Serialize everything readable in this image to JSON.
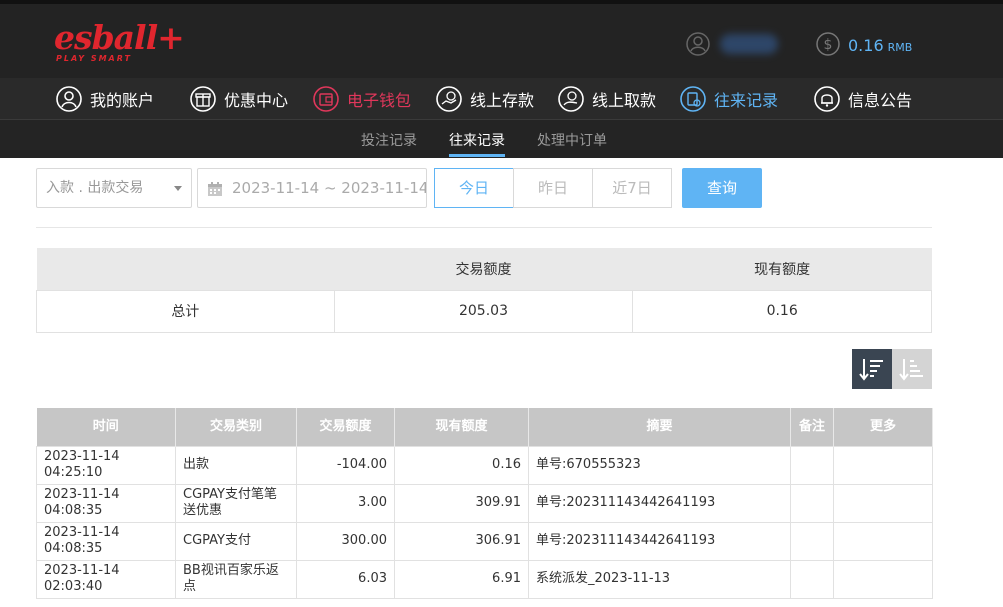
{
  "brand": {
    "logo_text": "esball+",
    "tagline": "PLAY SMART",
    "accent": "#e0262e"
  },
  "header": {
    "balance_value": "0.16",
    "balance_unit": "RMB"
  },
  "nav": [
    {
      "label": "我的账户",
      "icon": "user-icon"
    },
    {
      "label": "优惠中心",
      "icon": "gift-icon"
    },
    {
      "label": "电子钱包",
      "icon": "wallet-icon"
    },
    {
      "label": "线上存款",
      "icon": "deposit-icon"
    },
    {
      "label": "线上取款",
      "icon": "withdraw-icon"
    },
    {
      "label": "往来记录",
      "icon": "records-icon"
    },
    {
      "label": "信息公告",
      "icon": "bell-icon"
    }
  ],
  "subnav": [
    {
      "label": "投注记录"
    },
    {
      "label": "往来记录"
    },
    {
      "label": "处理中订单"
    }
  ],
  "filters": {
    "type_select": "入款 . 出款交易",
    "date_range": "2023-11-14 ~ 2023-11-14",
    "quick": [
      "今日",
      "昨日",
      "近7日"
    ],
    "query_label": "查询"
  },
  "summary": {
    "headers": [
      "",
      "交易额度",
      "现有额度"
    ],
    "row": [
      "总计",
      "205.03",
      "0.16"
    ]
  },
  "records": {
    "headers": [
      "时间",
      "交易类别",
      "交易额度",
      "现有额度",
      "摘要",
      "备注",
      "更多"
    ],
    "rows": [
      [
        "2023-11-14 04:25:10",
        "出款",
        "-104.00",
        "0.16",
        "单号:670555323",
        "",
        ""
      ],
      [
        "2023-11-14 04:08:35",
        "CGPAY支付笔笔送优惠",
        "3.00",
        "309.91",
        "单号:202311143442641193",
        "",
        ""
      ],
      [
        "2023-11-14 04:08:35",
        "CGPAY支付",
        "300.00",
        "306.91",
        "单号:202311143442641193",
        "",
        ""
      ],
      [
        "2023-11-14 02:03:40",
        "BB视讯百家乐返点",
        "6.03",
        "6.91",
        "系统派发_2023-11-13",
        "",
        ""
      ]
    ]
  },
  "colors": {
    "accent_blue": "#5fb4f4",
    "active_red": "#e0375b",
    "header_bg": "#232323"
  }
}
